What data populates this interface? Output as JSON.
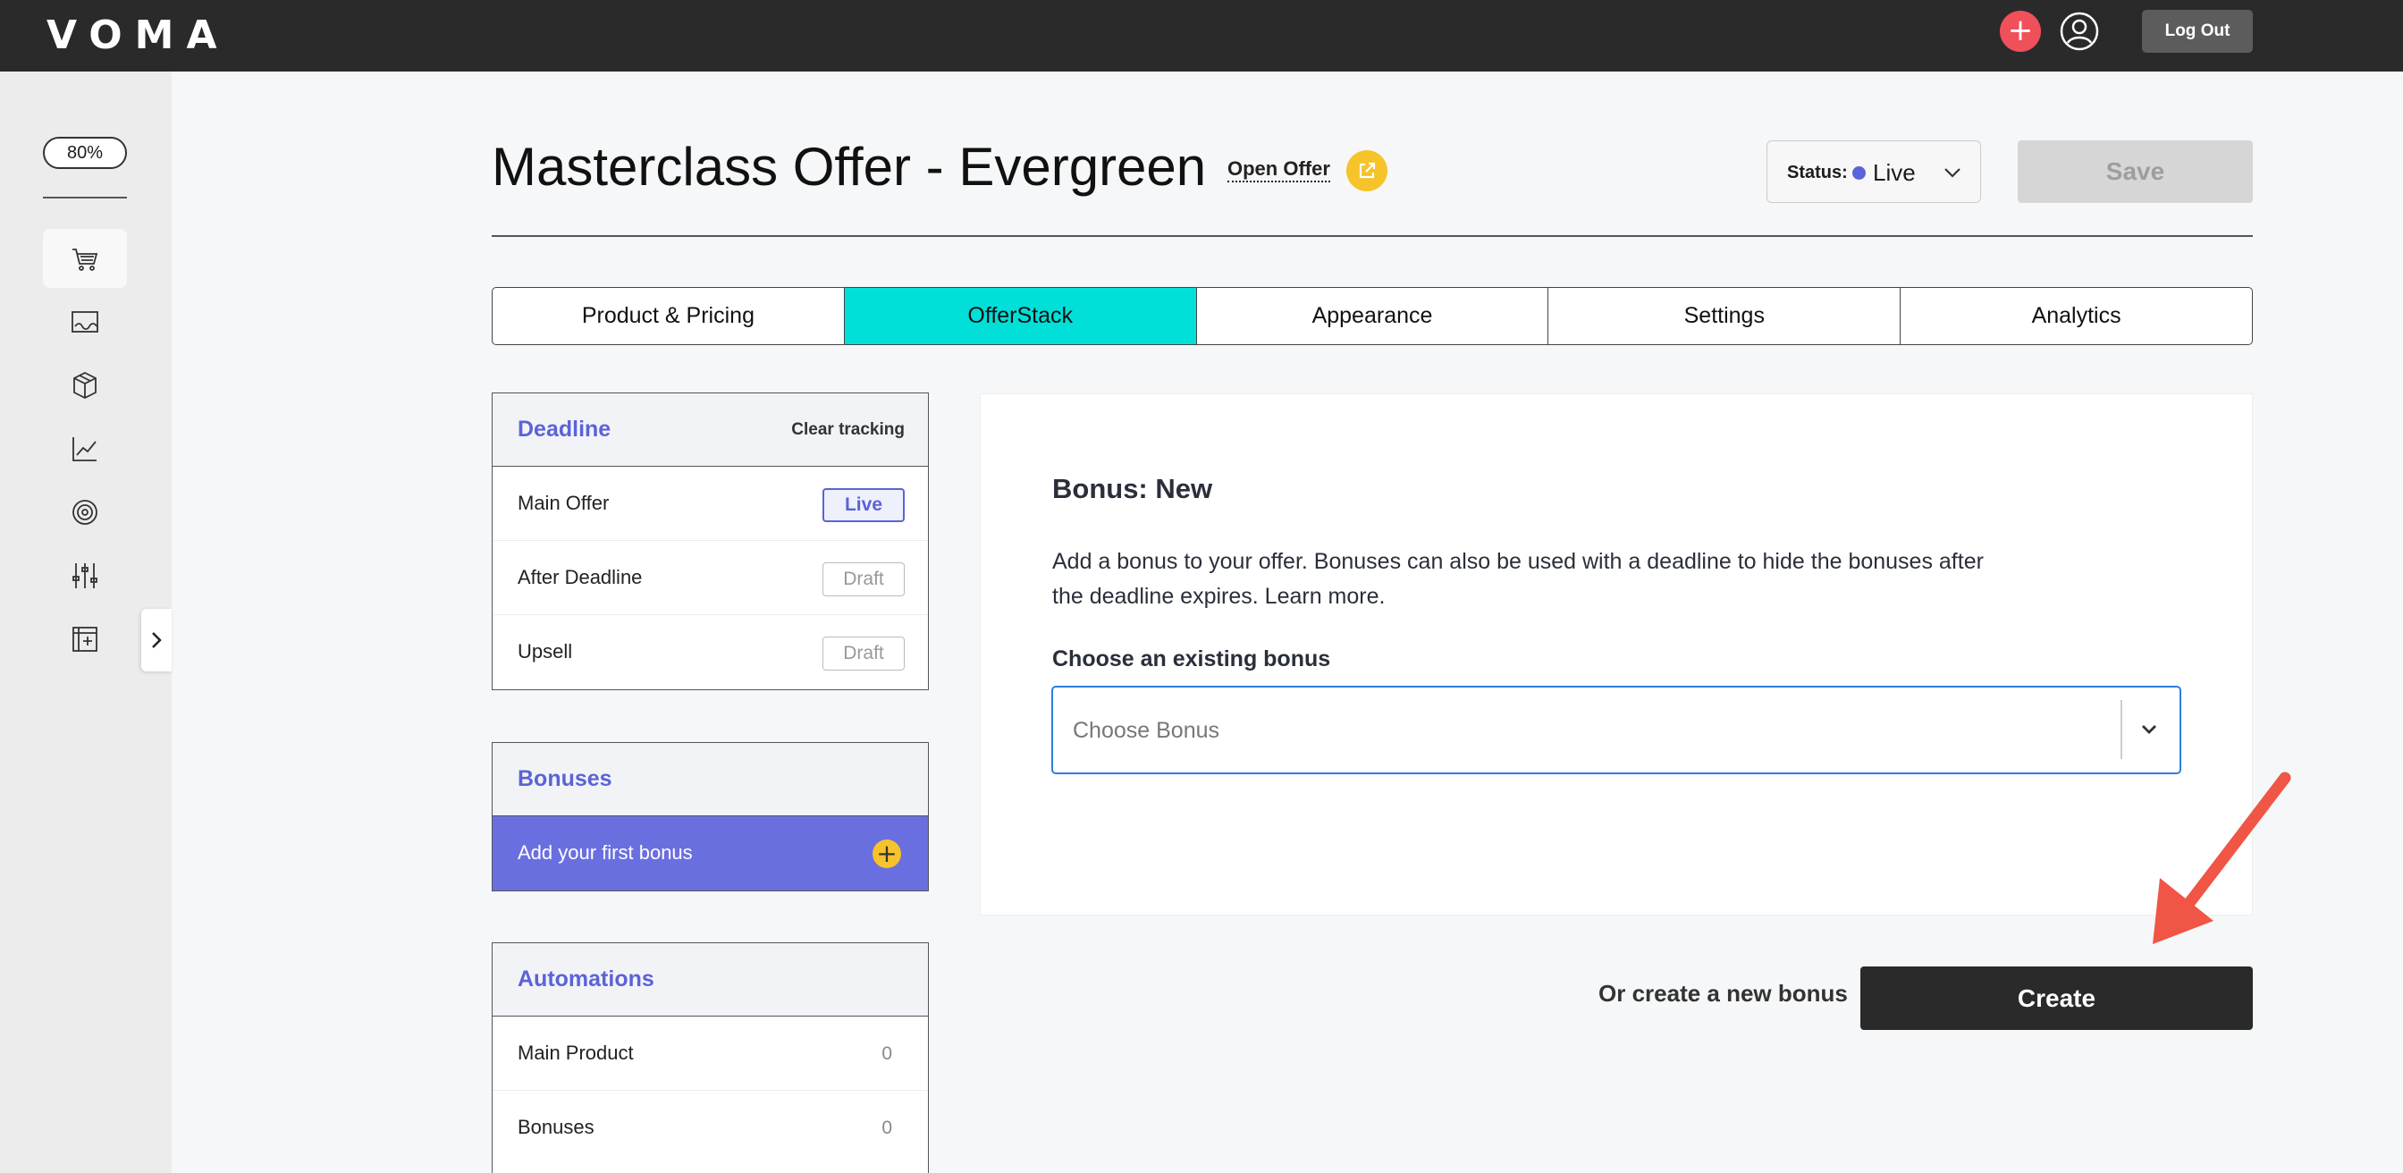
{
  "app": {
    "logo_text": "VOMA",
    "logout_label": "Log Out"
  },
  "sidebar": {
    "zoom_level": "80%",
    "icons": [
      "cart-icon",
      "sales-page-icon",
      "box-icon",
      "chart-icon",
      "target-icon",
      "sliders-icon",
      "add-grid-icon"
    ]
  },
  "header": {
    "title": "Masterclass Offer - Evergreen",
    "open_offer_label": "Open Offer",
    "status_label": "Status:",
    "status_value": "Live",
    "save_label": "Save"
  },
  "tabs": [
    {
      "label": "Product & Pricing",
      "active": false
    },
    {
      "label": "OfferStack",
      "active": true
    },
    {
      "label": "Appearance",
      "active": false
    },
    {
      "label": "Settings",
      "active": false
    },
    {
      "label": "Analytics",
      "active": false
    }
  ],
  "deadline_panel": {
    "title": "Deadline",
    "action": "Clear tracking",
    "rows": [
      {
        "label": "Main Offer",
        "status": "Live"
      },
      {
        "label": "After Deadline",
        "status": "Draft"
      },
      {
        "label": "Upsell",
        "status": "Draft"
      }
    ]
  },
  "bonuses_panel": {
    "title": "Bonuses",
    "add_label": "Add your first bonus"
  },
  "automations_panel": {
    "title": "Automations",
    "rows": [
      {
        "label": "Main Product",
        "count": "0"
      },
      {
        "label": "Bonuses",
        "count": "0"
      }
    ]
  },
  "bonus_form": {
    "title": "Bonus: New",
    "description": "Add a bonus to your offer. Bonuses can also be used with a deadline to hide the bonuses after the deadline expires. Learn more.",
    "choose_label": "Choose an existing bonus",
    "choose_placeholder": "Choose Bonus",
    "or_create_label": "Or create a new bonus",
    "create_label": "Create"
  },
  "colors": {
    "accent": "#5b63d8",
    "active_tab": "#00e0d8",
    "topbar": "#2a2a2a",
    "annotation_arrow": "#f05545",
    "add_icon": "#f6c32b"
  }
}
